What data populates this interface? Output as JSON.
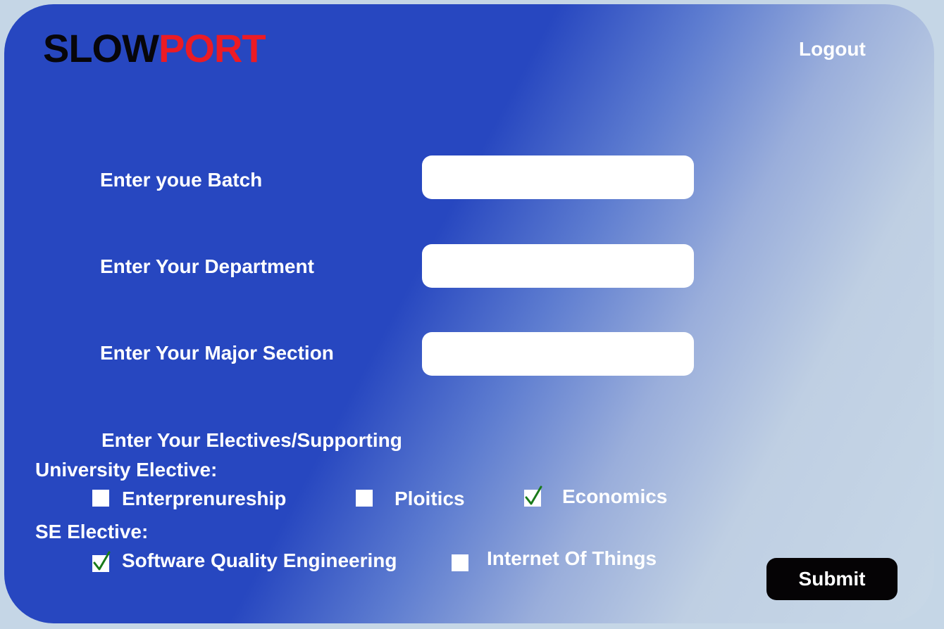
{
  "header": {
    "logo_part1": "SLOW",
    "logo_part2": "PORT",
    "logout_label": "Logout"
  },
  "form": {
    "batch_label": "Enter  youe Batch",
    "batch_value": "",
    "department_label": "Enter Your Department",
    "department_value": "",
    "major_label": "Enter Your Major Section",
    "major_value": "",
    "electives_heading": "Enter Your Electives/Supporting"
  },
  "university_elective": {
    "title": "University Elective:",
    "options": [
      {
        "label": "Enterprenureship",
        "checked": false
      },
      {
        "label": "Ploitics",
        "checked": false
      },
      {
        "label": "Economics",
        "checked": true
      }
    ]
  },
  "se_elective": {
    "title": "SE Elective:",
    "options": [
      {
        "label": "Software Quality Engineering",
        "checked": true
      },
      {
        "label": "Internet Of Things",
        "checked": false
      }
    ]
  },
  "submit_label": "Submit",
  "colors": {
    "primary_blue": "#2747c0",
    "logo_dark": "#07060a",
    "logo_red": "#ec1b24",
    "check_green": "#1a7a1a",
    "button_black": "#050305"
  }
}
